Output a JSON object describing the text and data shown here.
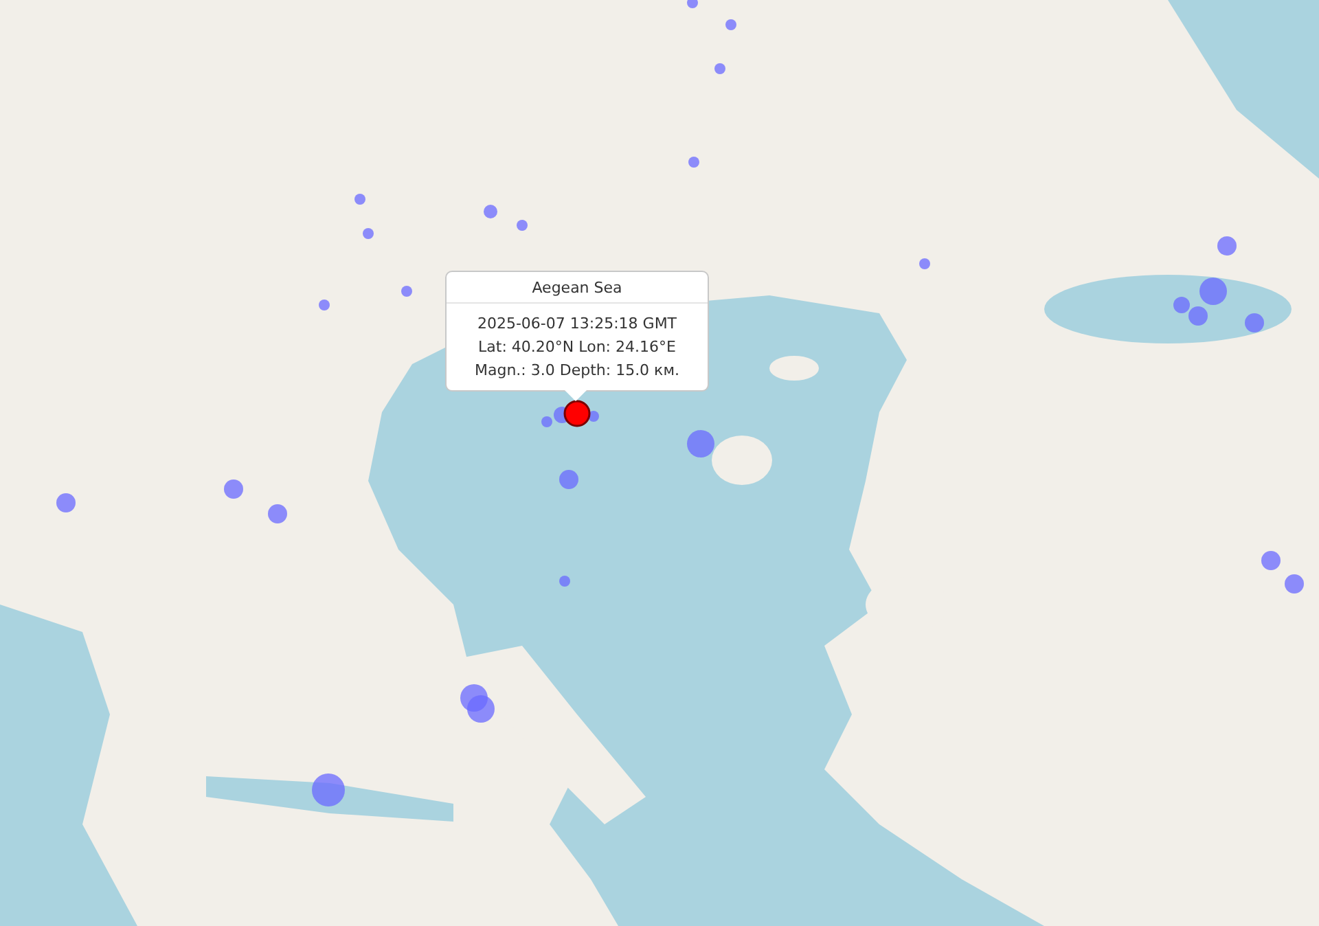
{
  "popup": {
    "title": "Aegean Sea",
    "lines": [
      "2025-06-07 13:25:18 GMT",
      "Lat: 40.20°N Lon: 24.16°E",
      "Magn.: 3.0 Depth: 15.0 км."
    ]
  }
}
